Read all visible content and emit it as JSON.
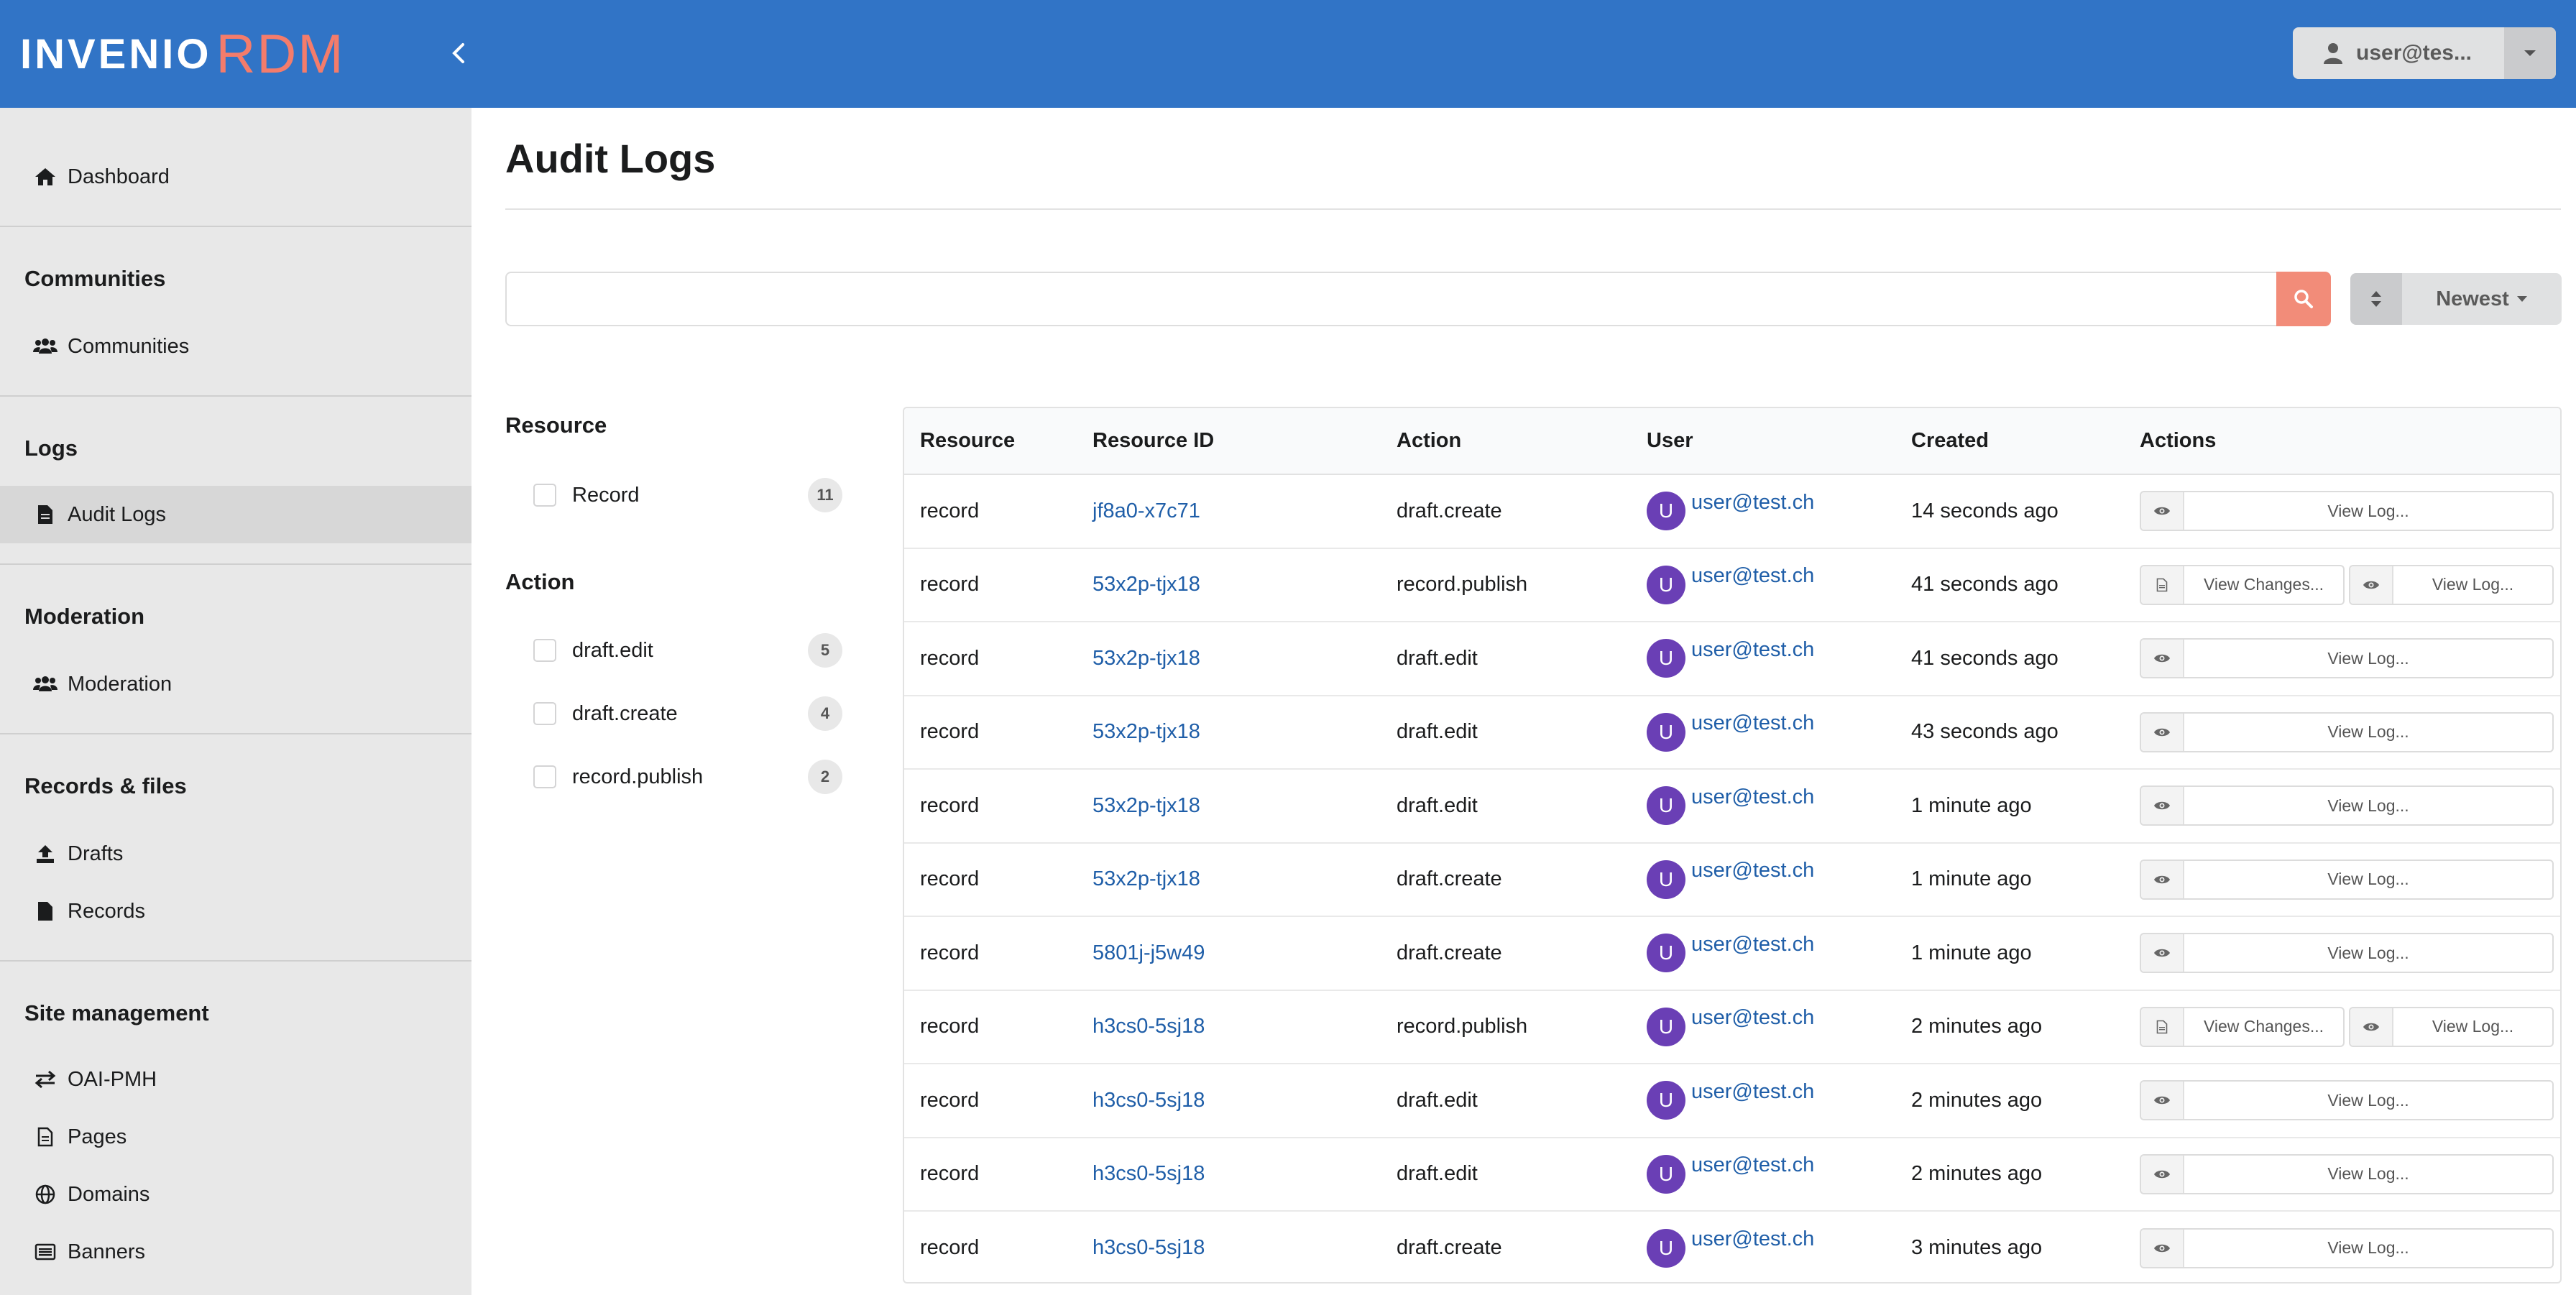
{
  "brand": {
    "name_part1": "INVENIO",
    "name_part2": "RDM"
  },
  "user_menu": {
    "label": "user@tes..."
  },
  "sidebar": {
    "dashboard": "Dashboard",
    "sections": [
      {
        "header": "Communities",
        "items": [
          "Communities"
        ]
      },
      {
        "header": "Logs",
        "items": [
          "Audit Logs"
        ]
      },
      {
        "header": "Moderation",
        "items": [
          "Moderation"
        ]
      },
      {
        "header": "Records & files",
        "items": [
          "Drafts",
          "Records"
        ]
      },
      {
        "header": "Site management",
        "items": [
          "OAI-PMH",
          "Pages",
          "Domains",
          "Banners"
        ]
      }
    ]
  },
  "page": {
    "title": "Audit Logs"
  },
  "search": {
    "value": "",
    "placeholder": ""
  },
  "sort": {
    "selected": "Newest"
  },
  "facets": {
    "resource": {
      "title": "Resource",
      "items": [
        {
          "label": "Record",
          "count": "11"
        }
      ]
    },
    "action": {
      "title": "Action",
      "items": [
        {
          "label": "draft.edit",
          "count": "5"
        },
        {
          "label": "draft.create",
          "count": "4"
        },
        {
          "label": "record.publish",
          "count": "2"
        }
      ]
    }
  },
  "table": {
    "columns": [
      "Resource",
      "Resource ID",
      "Action",
      "User",
      "Created",
      "Actions"
    ],
    "view_log_label": "View Log...",
    "view_changes_label": "View Changes...",
    "rows": [
      {
        "resource": "record",
        "resource_id": "jf8a0-x7c71",
        "action": "draft.create",
        "user_initial": "U",
        "user": "user@test.ch",
        "created": "14 seconds ago",
        "changes": false
      },
      {
        "resource": "record",
        "resource_id": "53x2p-tjx18",
        "action": "record.publish",
        "user_initial": "U",
        "user": "user@test.ch",
        "created": "41 seconds ago",
        "changes": true
      },
      {
        "resource": "record",
        "resource_id": "53x2p-tjx18",
        "action": "draft.edit",
        "user_initial": "U",
        "user": "user@test.ch",
        "created": "41 seconds ago",
        "changes": false
      },
      {
        "resource": "record",
        "resource_id": "53x2p-tjx18",
        "action": "draft.edit",
        "user_initial": "U",
        "user": "user@test.ch",
        "created": "43 seconds ago",
        "changes": false
      },
      {
        "resource": "record",
        "resource_id": "53x2p-tjx18",
        "action": "draft.edit",
        "user_initial": "U",
        "user": "user@test.ch",
        "created": "1 minute ago",
        "changes": false
      },
      {
        "resource": "record",
        "resource_id": "53x2p-tjx18",
        "action": "draft.create",
        "user_initial": "U",
        "user": "user@test.ch",
        "created": "1 minute ago",
        "changes": false
      },
      {
        "resource": "record",
        "resource_id": "5801j-j5w49",
        "action": "draft.create",
        "user_initial": "U",
        "user": "user@test.ch",
        "created": "1 minute ago",
        "changes": false
      },
      {
        "resource": "record",
        "resource_id": "h3cs0-5sj18",
        "action": "record.publish",
        "user_initial": "U",
        "user": "user@test.ch",
        "created": "2 minutes ago",
        "changes": true
      },
      {
        "resource": "record",
        "resource_id": "h3cs0-5sj18",
        "action": "draft.edit",
        "user_initial": "U",
        "user": "user@test.ch",
        "created": "2 minutes ago",
        "changes": false
      },
      {
        "resource": "record",
        "resource_id": "h3cs0-5sj18",
        "action": "draft.edit",
        "user_initial": "U",
        "user": "user@test.ch",
        "created": "2 minutes ago",
        "changes": false
      },
      {
        "resource": "record",
        "resource_id": "h3cs0-5sj18",
        "action": "draft.create",
        "user_initial": "U",
        "user": "user@test.ch",
        "created": "3 minutes ago",
        "changes": false
      }
    ]
  },
  "colors": {
    "topbar": "#3174c6",
    "accent": "#f28c79",
    "link": "#1f5ea8",
    "avatar": "#6a3fb5"
  }
}
